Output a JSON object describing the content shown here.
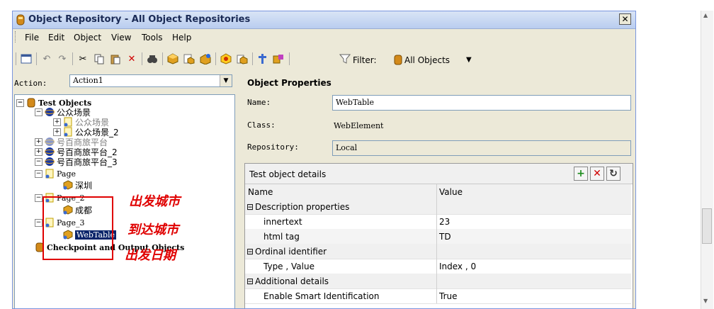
{
  "window": {
    "title": "Object Repository - All Object Repositories",
    "close_glyph": "✕"
  },
  "menu": [
    "File",
    "Edit",
    "Object",
    "View",
    "Tools",
    "Help"
  ],
  "toolbar": {
    "filter_label": "Filter:",
    "filter_value": "All Objects"
  },
  "action": {
    "label": "Action:",
    "value": "Action1"
  },
  "tree": {
    "root": "Test Objects",
    "items": [
      {
        "label": "公众场景"
      },
      {
        "label": "公众场景"
      },
      {
        "label": "公众场景_2"
      },
      {
        "label": "号百商旅平台"
      },
      {
        "label": "号百商旅平台_2"
      },
      {
        "label": "号百商旅平台_3"
      },
      {
        "label": "Page"
      },
      {
        "label": "深圳"
      },
      {
        "label": "Page_2"
      },
      {
        "label": "成都"
      },
      {
        "label": "Page_3"
      },
      {
        "label": "WebTable"
      }
    ],
    "checkpoint": "Checkpoint and Output Objects"
  },
  "annotations": [
    "出发城市",
    "到达城市",
    "出发日期"
  ],
  "properties": {
    "title": "Object Properties",
    "name_label": "Name:",
    "name_value": "WebTable",
    "class_label": "Class:",
    "class_value": "WebElement",
    "repository_label": "Repository:",
    "repository_value": "Local"
  },
  "details": {
    "title": "Test object details",
    "columns": [
      "Name",
      "Value"
    ],
    "rows": [
      {
        "type": "group",
        "name": "Description properties",
        "value": ""
      },
      {
        "type": "item",
        "name": "innertext",
        "value": "23"
      },
      {
        "type": "item",
        "name": "html tag",
        "value": "TD"
      },
      {
        "type": "group",
        "name": "Ordinal identifier",
        "value": ""
      },
      {
        "type": "item",
        "name": "Type , Value",
        "value": "Index , 0"
      },
      {
        "type": "group",
        "name": "Additional details",
        "value": ""
      },
      {
        "type": "item",
        "name": "Enable Smart Identification",
        "value": "True"
      }
    ]
  },
  "icons": {
    "add": "plus-icon",
    "delete": "delete-icon",
    "refresh": "refresh-icon",
    "filter": "filter-icon",
    "expand": "expand-icon",
    "collapse": "collapse-icon"
  },
  "colors": {
    "accent": "#0a246a",
    "annotation": "#e00000",
    "add": "#1a8c1a",
    "delete": "#d00000"
  }
}
